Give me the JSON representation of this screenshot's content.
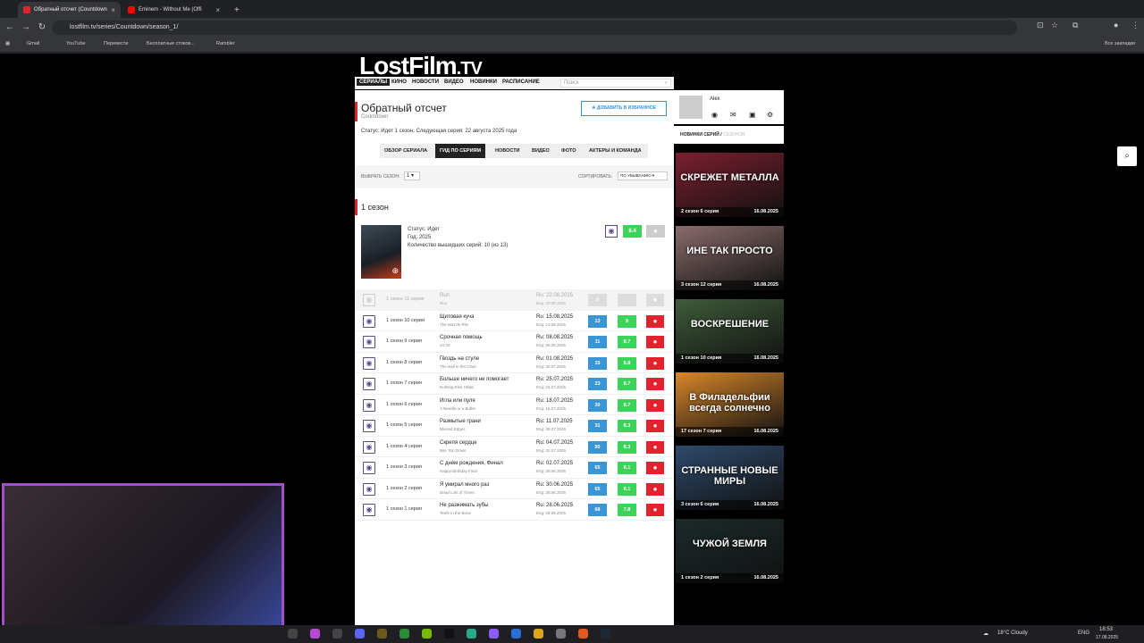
{
  "browser": {
    "tabs": [
      {
        "label": "Обратный отсчет (Countdown"
      },
      {
        "label": "Eminem - Without Me (Offi"
      }
    ],
    "url": "lostfilm.tv/series/Countdown/season_1/",
    "bookmarks": [
      "Gmail",
      "YouTube",
      "Перевести",
      "Бесплатные стоков...",
      "Rambler"
    ],
    "all_bookmarks": "Все закладки"
  },
  "site": {
    "logo": "LostFilm",
    "logo_tld": ".TV",
    "nav": [
      "СЕРИАЛЫ",
      "КИНО",
      "НОВОСТИ",
      "ВИДЕО",
      "НОВИНКИ",
      "РАСПИСАНИЕ"
    ],
    "search_placeholder": "Поиск"
  },
  "series": {
    "title": "Обратный отсчет",
    "subtitle": "Countdown",
    "favorite_button": "ДОБАВИТЬ В ИЗБРАННОЕ",
    "status_line": "Статус: Идет 1 сезон. Следующая серия: 22 августа 2025 года",
    "tabs": [
      "ОБЗОР СЕРИАЛА",
      "ГИД ПО СЕРИЯМ",
      "НОВОСТИ",
      "ВИДЕО",
      "ФОТО",
      "АКТЕРЫ И КОМАНДА"
    ],
    "season_label": "ВЫБРАТЬ СЕЗОН:",
    "season_value": "1",
    "sort_label": "СОРТИРОВАТЬ:",
    "sort_value": "ПО УБЫВАНИЮ"
  },
  "season": {
    "heading": "1 сезон",
    "status": "Статус: Идет",
    "year": "Год: 2025",
    "count": "Количество вышедших серий: 10 (из 13)",
    "rating": "8.4"
  },
  "episodes": [
    {
      "num": "1 сезон 11 серия",
      "ru": "Run",
      "en": "Run",
      "date_ru": "Ru: 22.08.2025",
      "date_en": "Eng: 20.08.2025",
      "count": "0",
      "rating": "",
      "upcoming": true
    },
    {
      "num": "1 сезон 10 серия",
      "ru": "Щитовая куча",
      "en": "The Muzzle Pile",
      "date_ru": "Ru: 15.08.2025",
      "date_en": "Eng: 13.08.2025",
      "count": "13",
      "rating": "9"
    },
    {
      "num": "1 сезон 9 серия",
      "ru": "Срочная помощь",
      "en": "10-33",
      "date_ru": "Ru: 08.08.2025",
      "date_en": "Eng: 06.08.2025",
      "count": "11",
      "rating": "8.7"
    },
    {
      "num": "1 сезон 8 серия",
      "ru": "Гвоздь на стуле",
      "en": "The Nail in the Chair",
      "date_ru": "Ru: 01.08.2025",
      "date_en": "Eng: 30.07.2025",
      "count": "15",
      "rating": "8.8"
    },
    {
      "num": "1 сезон 7 серия",
      "ru": "Больше ничего не помогает",
      "en": "Nothing Else Helps",
      "date_ru": "Ru: 25.07.2025",
      "date_en": "Eng: 23.07.2025",
      "count": "23",
      "rating": "8.7"
    },
    {
      "num": "1 сезон 6 серия",
      "ru": "Игла или пуля",
      "en": "A Needle or a Bullet",
      "date_ru": "Ru: 18.07.2025",
      "date_en": "Eng: 16.07.2025",
      "count": "30",
      "rating": "8.7"
    },
    {
      "num": "1 сезон 5 серия",
      "ru": "Размытые грани",
      "en": "Blurred Edges",
      "date_ru": "Ru: 11.07.2025",
      "date_en": "Eng: 09.07.2025",
      "count": "31",
      "rating": "8.3"
    },
    {
      "num": "1 сезон 4 серия",
      "ru": "Скрепя сердце",
      "en": "Bite 'Em Down",
      "date_ru": "Ru: 04.07.2025",
      "date_en": "Eng: 02.07.2025",
      "count": "50",
      "rating": "8.3"
    },
    {
      "num": "1 сезон 3 серия",
      "ru": "С днём рождения, Финал",
      "en": "Happy Birthday Final",
      "date_ru": "Ru: 02.07.2025",
      "date_en": "Eng: 28.06.2025",
      "count": "65",
      "rating": "8.1"
    },
    {
      "num": "1 сезон 2 серия",
      "ru": "Я умирал много раз",
      "en": "Dead Lots of Times",
      "date_ru": "Ru: 30.06.2025",
      "date_en": "Eng: 28.06.2025",
      "count": "65",
      "rating": "8.1"
    },
    {
      "num": "1 сезон 1 серия",
      "ru": "Не разжимать зубы",
      "en": "Teeth in the Bone",
      "date_ru": "Ru: 28.06.2025",
      "date_en": "Eng: 28.06.2025",
      "count": "68",
      "rating": "7.8"
    }
  ],
  "sidebar": {
    "user": "Alex",
    "new_label": "НОВИНКИ СЕРИЙ",
    "new_alt": "СЕЗОНОВ",
    "cards": [
      {
        "title": "СКРЕЖЕТ МЕТАЛЛА",
        "meta": "2 сезон 6 серия",
        "date": "16.08.2025",
        "color": "#7b1f2f"
      },
      {
        "title": "ИНЕ ТАК ПРОСТО",
        "meta": "3 сезон 12 серия",
        "date": "16.08.2025",
        "color": "#8a6b6b"
      },
      {
        "title": "ВОСКРЕШЕНИЕ",
        "meta": "1 сезон 10 серия",
        "date": "16.08.2025",
        "color": "#3f5b3a"
      },
      {
        "title": "В Филадельфии всегда солнечно",
        "meta": "17 сезон 7 серия",
        "date": "16.08.2025",
        "color": "#d9862a"
      },
      {
        "title": "СТРАННЫЕ НОВЫЕ МИРЫ",
        "meta": "3 сезон 6 серия",
        "date": "16.08.2025",
        "color": "#2e4a6b"
      },
      {
        "title": "ЧУЖОЙ ЗЕМЛЯ",
        "meta": "1 сезон 2 серия",
        "date": "16.08.2025",
        "color": "#1c2a2a"
      }
    ]
  },
  "taskbar": {
    "weather": "18°C  Cloudy",
    "lang": "ENG",
    "time": "18:53",
    "date": "17.08.2025"
  }
}
